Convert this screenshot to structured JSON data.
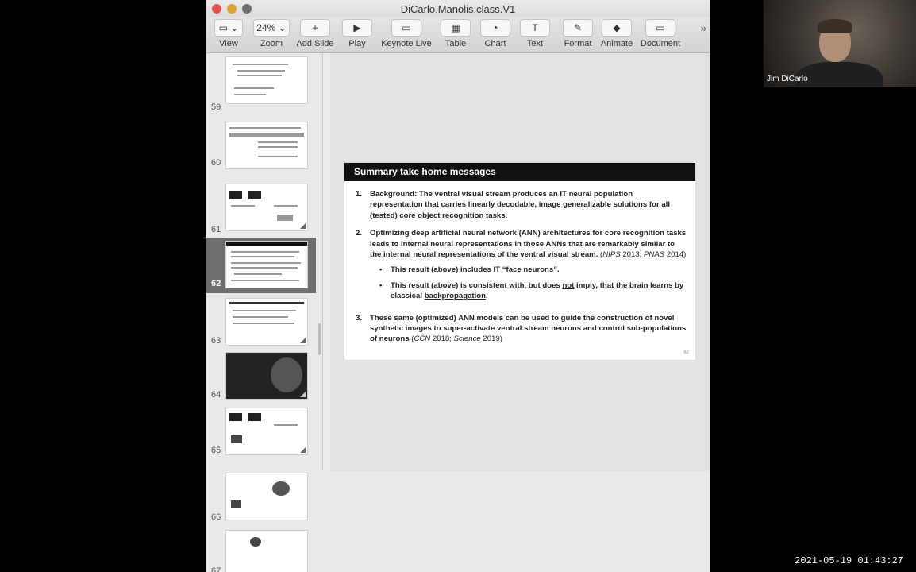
{
  "window": {
    "title": "DiCarlo.Manolis.class.V1"
  },
  "toolbar": {
    "items": [
      {
        "label": "View",
        "icon": "sidebar-icon",
        "button": "▭ ⌄"
      },
      {
        "label": "Zoom",
        "icon": "zoom-icon",
        "button": "24% ⌄"
      },
      {
        "label": "Add Slide",
        "icon": "plus-icon",
        "button": "+"
      },
      {
        "label": "Play",
        "icon": "play-icon",
        "button": "▶"
      },
      {
        "label": "Keynote Live",
        "icon": "keynote-live-icon",
        "button": "▭"
      },
      {
        "label": "Table",
        "icon": "table-icon",
        "button": "▦"
      },
      {
        "label": "Chart",
        "icon": "chart-icon",
        "button": "◔"
      },
      {
        "label": "Text",
        "icon": "text-icon",
        "button": "T"
      },
      {
        "label": "Format",
        "icon": "format-brush-icon",
        "button": "✎"
      },
      {
        "label": "Animate",
        "icon": "animate-icon",
        "button": "◆"
      },
      {
        "label": "Document",
        "icon": "document-icon",
        "button": "▭"
      }
    ],
    "overflow": "»"
  },
  "navigator": {
    "slides": [
      "59",
      "60",
      "61",
      "62",
      "63",
      "64",
      "65",
      "66",
      "67"
    ],
    "selected": "62"
  },
  "slide": {
    "heading": "Summary take home messages",
    "page_number": "62",
    "items": [
      {
        "n": "1.",
        "text": "Background: The ventral visual stream produces an IT neural population representation that carries linearly decodable, image generalizable solutions for all (tested) core object recognition tasks."
      },
      {
        "n": "2.",
        "text": "Optimizing deep artificial neural network (ANN) architectures for core recognition tasks leads to internal neural representations in those ANNs that are remarkably similar to the internal neural representations of the ventral visual stream.",
        "cite_a": "NIPS",
        "cite_a_year": "2013,",
        "cite_b": "PNAS",
        "cite_b_year": "2014)",
        "bullet1": "This result (above) includes IT “face neurons”.",
        "bullet2_pre": "This result (above) is consistent with, but does",
        "bullet2_not": "not",
        "bullet2_mid": "imply, that the brain learns by classical",
        "bullet2_bp": "backpropagation",
        "bullet2_end": "."
      },
      {
        "n": "3.",
        "text": "These same (optimized) ANN models can be used to guide the construction of novel synthetic images to super-activate ventral stream neurons and control sub-populations of neurons",
        "cite_a": "CCN",
        "cite_a_year": "2018;",
        "cite_b": "Science",
        "cite_b_year": "2019)"
      }
    ]
  },
  "video": {
    "participant": "Jim DiCarlo"
  },
  "timestamp": "2021-05-19 01:43:27"
}
